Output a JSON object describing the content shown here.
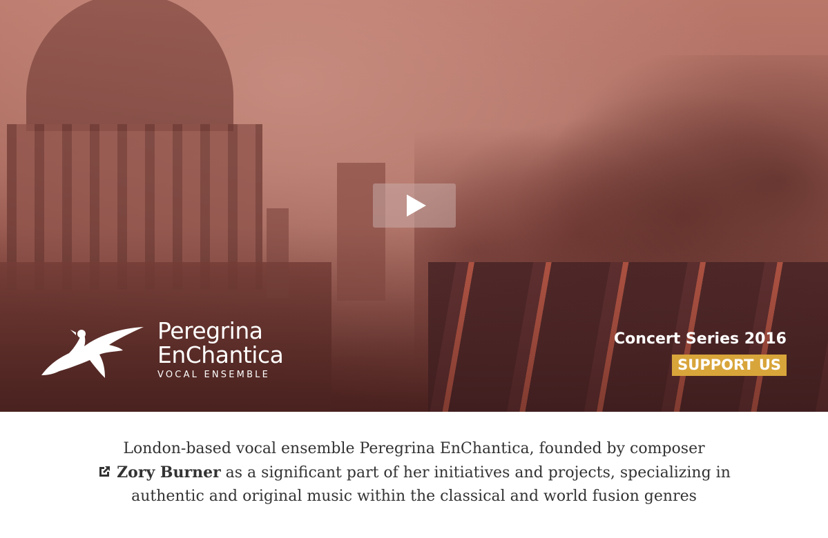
{
  "hero": {
    "logo": {
      "line1": "Peregrina",
      "line2": "EnChantica",
      "line3": "VOCAL ENSEMBLE"
    },
    "concert_title": "Concert Series 2016",
    "support_label": "SUPPORT US",
    "colors": {
      "support_bg": "#d8a53b",
      "overlay": "#a8675c"
    }
  },
  "intro": {
    "text_before": "London-based vocal ensemble Peregrina EnChantica, founded by composer",
    "link_label": "Zory Burner",
    "text_after": " as a significant part of her initiatives and projects, specializing in",
    "text_line3": "authentic and original music within the classical and world fusion genres"
  }
}
